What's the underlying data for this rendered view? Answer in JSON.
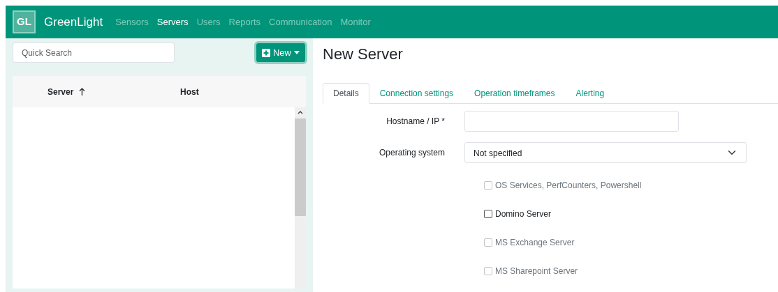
{
  "navbar": {
    "brand": "GreenLight",
    "logo_text": "GL",
    "items": [
      {
        "label": "Sensors",
        "selected": false
      },
      {
        "label": "Servers",
        "selected": true
      },
      {
        "label": "Users",
        "selected": false
      },
      {
        "label": "Reports",
        "selected": false
      },
      {
        "label": "Communication",
        "selected": false
      },
      {
        "label": "Monitor",
        "selected": false
      }
    ]
  },
  "sidebar": {
    "search": {
      "placeholder": "Quick Search"
    },
    "new_button": "New",
    "table": {
      "columns": [
        {
          "label": "Server",
          "sorted": true
        },
        {
          "label": "Host",
          "sorted": false
        }
      ]
    }
  },
  "form": {
    "title": "New Server",
    "tabs": [
      {
        "label": "Details",
        "selected": true
      },
      {
        "label": "Connection settings",
        "selected": false
      },
      {
        "label": "Operation timeframes",
        "selected": false
      },
      {
        "label": "Alerting",
        "selected": false
      }
    ],
    "hostname_label": "Hostname / IP *",
    "os_label": "Operating system",
    "os_value": "Not specified",
    "checkboxes": [
      {
        "label": "OS Services, PerfCounters, Powershell",
        "checked": false,
        "disabled": true
      },
      {
        "label": "Domino Server",
        "checked": false,
        "disabled": false
      },
      {
        "label": "MS Exchange Server",
        "checked": false,
        "disabled": true
      },
      {
        "label": "MS Sharepoint Server",
        "checked": false,
        "disabled": true
      }
    ]
  }
}
